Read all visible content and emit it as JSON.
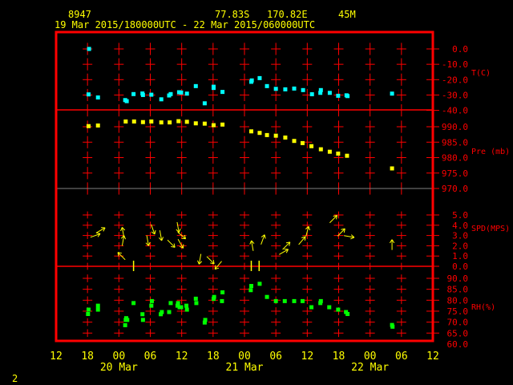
{
  "header": {
    "station": "8947",
    "lat": "77.83S",
    "lon": "170.82E",
    "elev": "45M",
    "period": "19 Mar 2015/180000UTC - 22 Mar 2015/060000UTC"
  },
  "footer": {
    "page": "2"
  },
  "colors": {
    "frame": "#ff0000",
    "temp": "#00ffff",
    "pressure": "#ffff00",
    "wind": "#ffff00",
    "rh": "#00ff00",
    "text": "#ffff00",
    "divider_gray": "#808080"
  },
  "chart_data": {
    "type": "scatter",
    "title": "8947 77.83S 170.82E 45M",
    "subtitle": "19 Mar 2015/180000UTC - 22 Mar 2015/060000UTC",
    "x_unit": "hours since 19 Mar 2015 12 UTC",
    "xlim": [
      0,
      72
    ],
    "x_ticks": [
      "12",
      "18",
      "00",
      "06",
      "12",
      "18",
      "00",
      "06",
      "12",
      "18",
      "00",
      "06",
      "12"
    ],
    "x_day_labels": [
      {
        "label": "20 Mar",
        "h": 12
      },
      {
        "label": "21 Mar",
        "h": 36
      },
      {
        "label": "22 Mar",
        "h": 60
      }
    ],
    "grid": true,
    "panels": [
      {
        "name": "temperature",
        "label": "T(C)",
        "ylim": [
          -40,
          0
        ],
        "ticks": [
          "0.0",
          "-10.0",
          "-20.0",
          "-30.0",
          "-40.0"
        ],
        "tick_values": [
          0,
          -10,
          -20,
          -30,
          -40
        ],
        "points": [
          [
            6.3,
            0.0
          ],
          [
            6.2,
            -29.6
          ],
          [
            8.0,
            -31.6
          ],
          [
            13.2,
            -33.3
          ],
          [
            13.5,
            -34.0
          ],
          [
            14.8,
            -29.4
          ],
          [
            16.5,
            -29.0
          ],
          [
            16.6,
            -30.0
          ],
          [
            18.2,
            -29.8
          ],
          [
            20.1,
            -32.8
          ],
          [
            21.6,
            -30.3
          ],
          [
            21.9,
            -29.4
          ],
          [
            23.5,
            -28.2
          ],
          [
            23.9,
            -28.4
          ],
          [
            25.0,
            -29.1
          ],
          [
            26.7,
            -24.2
          ],
          [
            28.4,
            -35.4
          ],
          [
            30.1,
            -24.6
          ],
          [
            30.1,
            -25.4
          ],
          [
            31.8,
            -28.0
          ],
          [
            37.3,
            -21.4
          ],
          [
            37.4,
            -20.5
          ],
          [
            38.9,
            -19.0
          ],
          [
            40.3,
            -24.2
          ],
          [
            42.0,
            -26.0
          ],
          [
            43.8,
            -26.3
          ],
          [
            45.5,
            -25.8
          ],
          [
            47.2,
            -26.8
          ],
          [
            48.9,
            -29.5
          ],
          [
            50.5,
            -28.6
          ],
          [
            50.6,
            -26.8
          ],
          [
            52.3,
            -28.6
          ],
          [
            53.9,
            -30.5
          ],
          [
            55.5,
            -30.2
          ],
          [
            55.7,
            -30.7
          ],
          [
            64.2,
            -29.1
          ]
        ]
      },
      {
        "name": "pressure",
        "label": "Pre (mb)",
        "ylim": [
          970,
          990
        ],
        "ticks": [
          "990.0",
          "985.0",
          "980.0",
          "975.0",
          "970.0"
        ],
        "tick_values": [
          990,
          985,
          980,
          975,
          970
        ],
        "points": [
          [
            6.2,
            990.2
          ],
          [
            8.0,
            990.4
          ],
          [
            13.3,
            991.7
          ],
          [
            14.9,
            991.7
          ],
          [
            16.6,
            991.5
          ],
          [
            18.2,
            991.7
          ],
          [
            20.1,
            991.4
          ],
          [
            21.7,
            991.4
          ],
          [
            23.4,
            991.8
          ],
          [
            25.0,
            991.6
          ],
          [
            26.7,
            991.1
          ],
          [
            28.4,
            991.0
          ],
          [
            30.1,
            990.5
          ],
          [
            31.8,
            990.7
          ],
          [
            37.3,
            988.5
          ],
          [
            38.9,
            988.0
          ],
          [
            40.3,
            987.3
          ],
          [
            42.0,
            987.1
          ],
          [
            43.8,
            986.5
          ],
          [
            45.5,
            985.4
          ],
          [
            47.1,
            984.7
          ],
          [
            48.8,
            983.7
          ],
          [
            50.6,
            982.7
          ],
          [
            52.3,
            981.9
          ],
          [
            53.9,
            981.3
          ],
          [
            55.6,
            980.6
          ],
          [
            64.2,
            976.5
          ]
        ]
      },
      {
        "name": "wind",
        "label": "SPD(MPS)",
        "ylim": [
          0,
          5
        ],
        "ticks": [
          "5.0",
          "4.0",
          "3.0",
          "2.0",
          "1.0",
          "0.0"
        ],
        "tick_values": [
          5,
          4,
          3,
          2,
          1,
          0
        ],
        "vectors_h_spd_dir": [
          [
            7.5,
            3.0,
            70
          ],
          [
            8.5,
            3.5,
            60
          ],
          [
            12.5,
            1.0,
            315
          ],
          [
            12.8,
            3.3,
            350
          ],
          [
            12.8,
            2.5,
            10
          ],
          [
            17.5,
            2.5,
            170
          ],
          [
            18.5,
            3.6,
            160
          ],
          [
            20.0,
            3.0,
            170
          ],
          [
            22.0,
            2.2,
            135
          ],
          [
            23.3,
            3.8,
            170
          ],
          [
            23.8,
            2.2,
            150
          ],
          [
            24.0,
            3.0,
            130
          ],
          [
            27.5,
            0.7,
            190
          ],
          [
            29.5,
            0.6,
            135
          ],
          [
            31.0,
            0.1,
            220
          ],
          [
            37.5,
            2.0,
            350
          ],
          [
            39.5,
            2.6,
            20
          ],
          [
            43.5,
            1.4,
            60
          ],
          [
            44.0,
            2.0,
            45
          ],
          [
            47.0,
            2.5,
            40
          ],
          [
            48.0,
            3.4,
            15
          ],
          [
            53.0,
            4.6,
            45
          ],
          [
            54.5,
            3.3,
            45
          ],
          [
            56.0,
            2.9,
            100
          ],
          [
            64.2,
            2.1,
            0
          ]
        ],
        "calm_h": [
          14.8,
          37.3,
          38.8
        ]
      },
      {
        "name": "rh",
        "label": "RH(%)",
        "ylim": [
          60,
          90
        ],
        "ticks": [
          "90.0",
          "85.0",
          "80.0",
          "75.0",
          "70.0",
          "65.0",
          "60.0"
        ],
        "tick_values": [
          90,
          85,
          80,
          75,
          70,
          65,
          60
        ],
        "points": [
          [
            6.2,
            75.7
          ],
          [
            6.1,
            73.7
          ],
          [
            8.0,
            77.5
          ],
          [
            8.0,
            75.7
          ],
          [
            13.2,
            68.6
          ],
          [
            13.4,
            71.8
          ],
          [
            13.3,
            71.0
          ],
          [
            13.6,
            71.0
          ],
          [
            14.8,
            78.7
          ],
          [
            16.5,
            73.6
          ],
          [
            16.6,
            71.0
          ],
          [
            18.3,
            79.6
          ],
          [
            18.2,
            77.5
          ],
          [
            20.0,
            73.6
          ],
          [
            20.2,
            74.6
          ],
          [
            21.6,
            74.6
          ],
          [
            21.9,
            78.7
          ],
          [
            23.3,
            78.7
          ],
          [
            23.2,
            77.5
          ],
          [
            23.6,
            76.8
          ],
          [
            23.9,
            76.8
          ],
          [
            24.9,
            77.5
          ],
          [
            25.0,
            75.7
          ],
          [
            26.7,
            80.7
          ],
          [
            26.8,
            78.7
          ],
          [
            28.4,
            69.8
          ],
          [
            28.5,
            71.0
          ],
          [
            30.1,
            80.6
          ],
          [
            30.2,
            81.5
          ],
          [
            31.8,
            83.6
          ],
          [
            31.7,
            79.6
          ],
          [
            37.2,
            84.6
          ],
          [
            37.3,
            86.5
          ],
          [
            38.9,
            87.5
          ],
          [
            40.3,
            81.5
          ],
          [
            42.0,
            79.6
          ],
          [
            43.7,
            79.6
          ],
          [
            45.5,
            79.6
          ],
          [
            47.1,
            79.6
          ],
          [
            48.8,
            76.8
          ],
          [
            50.5,
            78.7
          ],
          [
            50.6,
            79.6
          ],
          [
            52.2,
            76.8
          ],
          [
            53.9,
            75.7
          ],
          [
            55.4,
            74.6
          ],
          [
            55.7,
            73.7
          ],
          [
            64.2,
            68.7
          ],
          [
            64.3,
            67.9
          ]
        ]
      }
    ]
  }
}
